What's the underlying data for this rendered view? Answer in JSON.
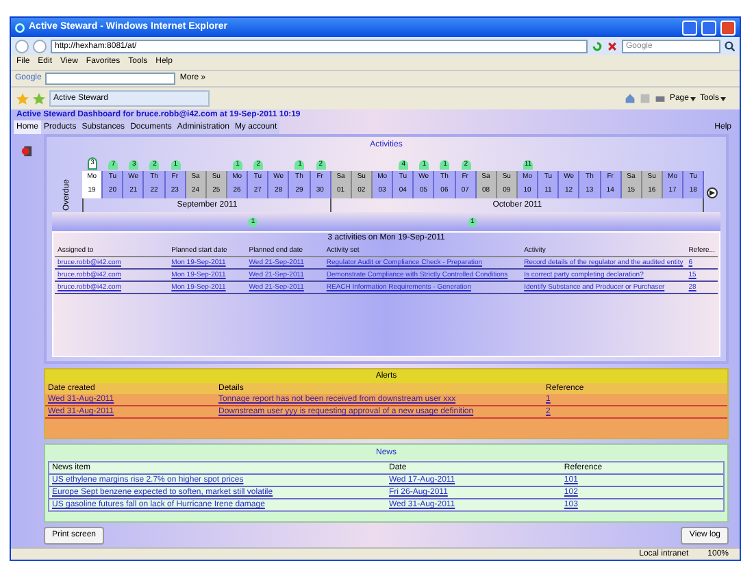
{
  "window": {
    "title": "Active Steward - Windows Internet Explorer"
  },
  "address_bar": {
    "url": "http://hexham:8081/at/",
    "search_placeholder": "Google"
  },
  "menu": [
    "File",
    "Edit",
    "View",
    "Favorites",
    "Tools",
    "Help"
  ],
  "google_toolbar": {
    "logo": "Google",
    "more": "More »"
  },
  "tab": {
    "label": "Active Steward"
  },
  "command_bar": {
    "page": "Page",
    "tools": "Tools"
  },
  "app": {
    "heading": "Active Steward Dashboard for bruce.robb@i42.com at 19-Sep-2011 10:19",
    "nav": [
      {
        "label": "Home",
        "selected": true
      },
      {
        "label": "Products",
        "selected": false
      },
      {
        "label": "Substances",
        "selected": false
      },
      {
        "label": "Documents",
        "selected": false
      },
      {
        "label": "Administration",
        "selected": false
      },
      {
        "label": "My account",
        "selected": false
      }
    ],
    "help": "Help"
  },
  "activities": {
    "title": "Activities",
    "overdue_label": "Overdue",
    "days": [
      {
        "weekday": "Mo",
        "date": "19",
        "count": "3",
        "weekend": false,
        "selected": true
      },
      {
        "weekday": "Tu",
        "date": "20",
        "count": "7",
        "weekend": false,
        "selected": false
      },
      {
        "weekday": "We",
        "date": "21",
        "count": "3",
        "weekend": false,
        "selected": false
      },
      {
        "weekday": "Th",
        "date": "22",
        "count": "2",
        "weekend": false,
        "selected": false
      },
      {
        "weekday": "Fr",
        "date": "23",
        "count": "1",
        "weekend": false,
        "selected": false
      },
      {
        "weekday": "Sa",
        "date": "24",
        "weekend": true,
        "selected": false
      },
      {
        "weekday": "Su",
        "date": "25",
        "weekend": true,
        "selected": false
      },
      {
        "weekday": "Mo",
        "date": "26",
        "count": "1",
        "weekend": false,
        "selected": false
      },
      {
        "weekday": "Tu",
        "date": "27",
        "count": "2",
        "weekend": false,
        "selected": false
      },
      {
        "weekday": "We",
        "date": "28",
        "weekend": false,
        "selected": false
      },
      {
        "weekday": "Th",
        "date": "29",
        "count": "1",
        "weekend": false,
        "selected": false
      },
      {
        "weekday": "Fr",
        "date": "30",
        "count": "2",
        "weekend": false,
        "selected": false
      },
      {
        "weekday": "Sa",
        "date": "01",
        "weekend": true,
        "selected": false
      },
      {
        "weekday": "Su",
        "date": "02",
        "weekend": true,
        "selected": false
      },
      {
        "weekday": "Mo",
        "date": "03",
        "weekend": false,
        "selected": false
      },
      {
        "weekday": "Tu",
        "date": "04",
        "count": "4",
        "weekend": false,
        "selected": false
      },
      {
        "weekday": "We",
        "date": "05",
        "count": "1",
        "weekend": false,
        "selected": false
      },
      {
        "weekday": "Th",
        "date": "06",
        "count": "1",
        "weekend": false,
        "selected": false
      },
      {
        "weekday": "Fr",
        "date": "07",
        "count": "2",
        "weekend": false,
        "selected": false
      },
      {
        "weekday": "Sa",
        "date": "08",
        "weekend": true,
        "selected": false
      },
      {
        "weekday": "Su",
        "date": "09",
        "weekend": true,
        "selected": false
      },
      {
        "weekday": "Mo",
        "date": "10",
        "count": "11",
        "weekend": false,
        "selected": false
      },
      {
        "weekday": "Tu",
        "date": "11",
        "weekend": false,
        "selected": false
      },
      {
        "weekday": "We",
        "date": "12",
        "weekend": false,
        "selected": false
      },
      {
        "weekday": "Th",
        "date": "13",
        "weekend": false,
        "selected": false
      },
      {
        "weekday": "Fr",
        "date": "14",
        "weekend": false,
        "selected": false
      },
      {
        "weekday": "Sa",
        "date": "15",
        "weekend": true,
        "selected": false
      },
      {
        "weekday": "Su",
        "date": "16",
        "weekend": true,
        "selected": false
      },
      {
        "weekday": "Mo",
        "date": "17",
        "weekend": false,
        "selected": false
      },
      {
        "weekday": "Tu",
        "date": "18",
        "weekend": false,
        "selected": false
      }
    ],
    "months": [
      "September 2011",
      "October 2011"
    ],
    "overdue_counts": [
      "1",
      "1"
    ],
    "caption": "3 activities on Mon 19-Sep-2011",
    "columns": [
      "Assigned to",
      "Planned start date",
      "Planned end date",
      "Activity set",
      "Activity",
      "Refere..."
    ],
    "rows": [
      [
        "bruce.robb@i42.com",
        "Mon 19-Sep-2011",
        "Wed 21-Sep-2011",
        "Regulator Audit or Compliance Check - Preparation",
        "Record details of the regulator and the audited entity",
        "6"
      ],
      [
        "bruce.robb@i42.com",
        "Mon 19-Sep-2011",
        "Wed 21-Sep-2011",
        "Demonstrate Compliance with Strictly Controlled Conditions",
        "Is correct party completing declaration?",
        "15"
      ],
      [
        "bruce.robb@i42.com",
        "Mon 19-Sep-2011",
        "Wed 21-Sep-2011",
        "REACH Information Requirements - Generation",
        "Identify Substance and Producer or Purchaser",
        "28"
      ]
    ]
  },
  "alerts": {
    "title": "Alerts",
    "columns": [
      "Date created",
      "Details",
      "Reference"
    ],
    "rows": [
      [
        "Wed 31-Aug-2011",
        "Tonnage report has not been received from downstream user xxx",
        "1"
      ],
      [
        "Wed 31-Aug-2011",
        "Downstream user yyy is requesting approval of a new usage definition",
        "2"
      ]
    ]
  },
  "news": {
    "title": "News",
    "columns": [
      "News item",
      "Date",
      "Reference"
    ],
    "rows": [
      [
        "US ethylene margins rise 2.7% on higher spot prices",
        "Wed 17-Aug-2011",
        "101"
      ],
      [
        "Europe Sept benzene expected to soften, market still volatile",
        "Fri 26-Aug-2011",
        "102"
      ],
      [
        "US gasoline futures fall on lack of Hurricane Irene damage",
        "Wed 31-Aug-2011",
        "103"
      ]
    ]
  },
  "buttons": [
    "Print screen",
    "View log"
  ],
  "status_bar": {
    "zone": "Local intranet",
    "zoom": "100%"
  }
}
